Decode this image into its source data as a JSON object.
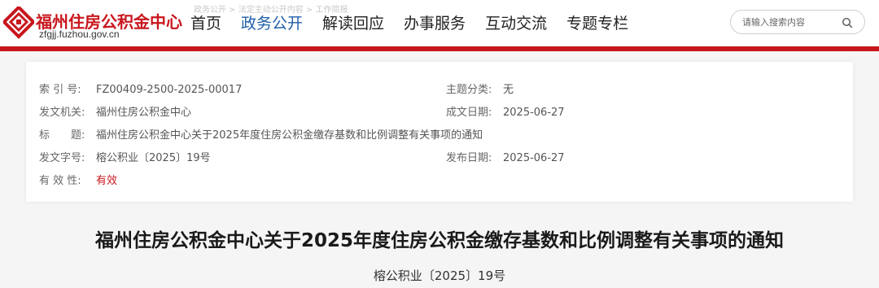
{
  "header": {
    "logo_title": "福州住房公积金中心",
    "logo_domain": "zfgjj.fuzhou.gov.cn",
    "breadcrumb_faint": "政务公开 > 法定主动公开内容 > 工作简报",
    "nav": [
      {
        "label": "首页",
        "active": false
      },
      {
        "label": "政务公开",
        "active": true
      },
      {
        "label": "解读回应",
        "active": false
      },
      {
        "label": "办事服务",
        "active": false
      },
      {
        "label": "互动交流",
        "active": false
      },
      {
        "label": "专题专栏",
        "active": false
      }
    ],
    "search": {
      "placeholder": "请输入搜索内容",
      "icon": "search-icon"
    }
  },
  "colors": {
    "brand_red": "#c8161d",
    "nav_active": "#1f5fa8"
  },
  "info": {
    "index_label": "索 引 号:",
    "index_value": "FZ00409-2500-2025-00017",
    "topic_label": "主题分类:",
    "topic_value": "无",
    "issuer_label": "发文机关:",
    "issuer_value": "福州住房公积金中心",
    "created_label": "成文日期:",
    "created_value": "2025-06-27",
    "title_label": "标　　题:",
    "title_value": "福州住房公积金中心关于2025年度住房公积金缴存基数和比例调整有关事项的通知",
    "docno_label": "发文字号:",
    "docno_value": "榕公积业〔2025〕19号",
    "published_label": "发布日期:",
    "published_value": "2025-06-27",
    "validity_label": "有 效 性:",
    "validity_value": "有效"
  },
  "article": {
    "title": "福州住房公积金中心关于2025年度住房公积金缴存基数和比例调整有关事项的通知",
    "doc_number": "榕公积业〔2025〕19号"
  }
}
